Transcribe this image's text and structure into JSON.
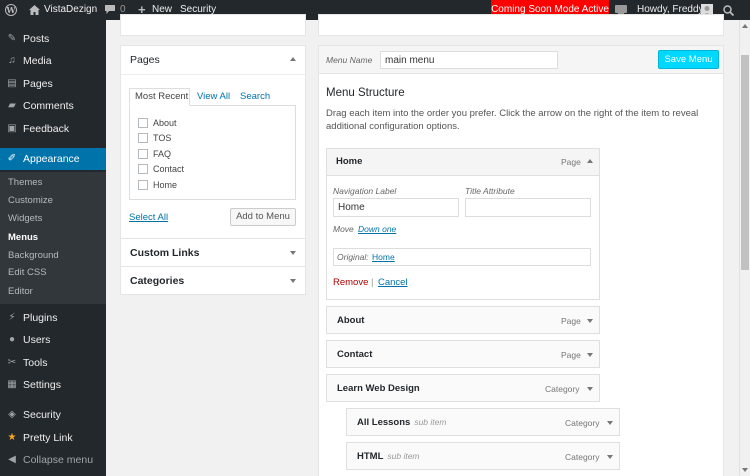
{
  "admin_bar": {
    "site_name": "VistaDezign",
    "comments_count": "0",
    "new_label": "New",
    "security_label": "Security",
    "coming_soon_label": "Coming Soon Mode Active",
    "howdy_label": "Howdy, Freddy"
  },
  "sidebar": {
    "items": [
      {
        "label": "Posts",
        "icon": "pin-icon"
      },
      {
        "label": "Media",
        "icon": "media-icon"
      },
      {
        "label": "Pages",
        "icon": "page-icon"
      },
      {
        "label": "Comments",
        "icon": "comment-icon"
      },
      {
        "label": "Feedback",
        "icon": "feedback-icon"
      },
      {
        "label": "Appearance",
        "icon": "brush-icon"
      },
      {
        "label": "Plugins",
        "icon": "plug-icon"
      },
      {
        "label": "Users",
        "icon": "user-icon"
      },
      {
        "label": "Tools",
        "icon": "wrench-icon"
      },
      {
        "label": "Settings",
        "icon": "settings-icon"
      },
      {
        "label": "Security",
        "icon": "shield-icon"
      },
      {
        "label": "Pretty Link",
        "icon": "star-icon"
      },
      {
        "label": "Collapse menu",
        "icon": "collapse-icon"
      }
    ],
    "submenu": [
      "Themes",
      "Customize",
      "Widgets",
      "Menus",
      "Background",
      "Edit CSS",
      "Editor"
    ]
  },
  "pages_box": {
    "title": "Pages",
    "tabs": [
      "Most Recent",
      "View All",
      "Search"
    ],
    "pages": [
      "About",
      "TOS",
      "FAQ",
      "Contact",
      "Home"
    ],
    "select_all": "Select All",
    "add_button": "Add to Menu"
  },
  "custom_links": {
    "title": "Custom Links"
  },
  "categories": {
    "title": "Categories"
  },
  "menu": {
    "name_label": "Menu Name",
    "name_value": "main menu",
    "save_button": "Save Menu",
    "structure_title": "Menu Structure",
    "instructions": "Drag each item into the order you prefer. Click the arrow on the right of the item to reveal additional configuration options.",
    "home_item": {
      "title": "Home",
      "type": "Page",
      "nav_label_caption": "Navigation Label",
      "title_attr_caption": "Title Attribute",
      "nav_label_value": "Home",
      "move_label": "Move",
      "move_link": "Down one",
      "original_label": "Original:",
      "original_link": "Home",
      "remove_label": "Remove",
      "separator": "|",
      "cancel_label": "Cancel"
    },
    "items": [
      {
        "title": "About",
        "type": "Page",
        "sub": ""
      },
      {
        "title": "Contact",
        "type": "Page",
        "sub": ""
      },
      {
        "title": "Learn Web Design",
        "type": "Category",
        "sub": ""
      },
      {
        "title": "All Lessons",
        "type": "Category",
        "sub": "sub item"
      },
      {
        "title": "HTML",
        "type": "Category",
        "sub": "sub item"
      }
    ]
  }
}
